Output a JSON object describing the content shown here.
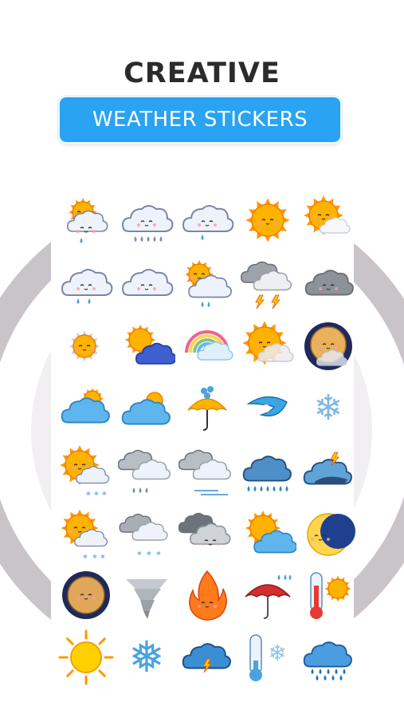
{
  "header": {
    "title": "CREATIVE",
    "subtitle": "WEATHER STICKERS"
  },
  "colors": {
    "banner": "#29a3f2",
    "ring": "#c9c4c8",
    "sun": "#ffb300",
    "cloud": "#eef2fa"
  },
  "stickers": [
    "sun-cloud-drop-icon",
    "cloud-drizzle-icon",
    "cloud-drop-icon",
    "sun-icon",
    "sun-cloud-icon",
    "cloud-rain-icon",
    "cloud-icon",
    "sun-cloud-rain-icon",
    "storm-cloud-icon",
    "dark-cloud-icon",
    "sun-outline-icon",
    "sun-blue-cloud-icon",
    "rainbow-cloud-icon",
    "sun-fog-icon",
    "moon-night-icon",
    "blue-cloud-sun-icon",
    "blue-cloud-icon",
    "umbrella-hail-icon",
    "cyclone-icon",
    "snowflake-icon",
    "sun-cloud-snow-icon",
    "grey-cloud-rain-icon",
    "grey-cloud-wind-icon",
    "blue-cloud-rain-icon",
    "blue-cloud-lightning-icon",
    "sun-cloud-hail-icon",
    "grey-cloud-snow-icon",
    "grey-clouds-icon",
    "sun-blue-cloud-2-icon",
    "crescent-moon-icon",
    "full-moon-icon",
    "tornado-icon",
    "fire-icon",
    "red-umbrella-rain-icon",
    "thermometer-hot-icon",
    "bright-sun-icon",
    "ice-snowflake-icon",
    "cloud-thunder-icon",
    "thermometer-cold-icon",
    "cloud-heavy-rain-icon"
  ]
}
